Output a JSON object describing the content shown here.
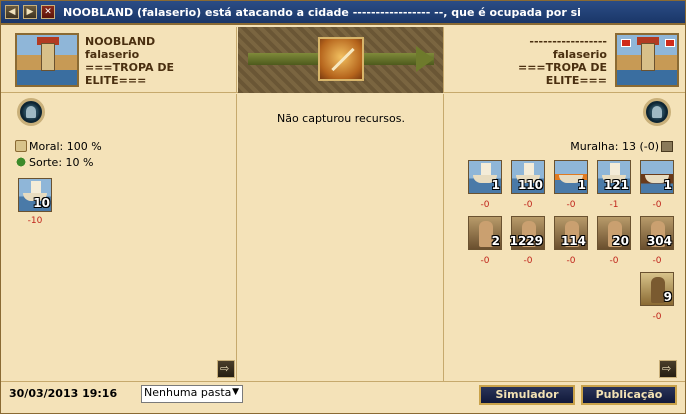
{
  "window": {
    "title": "NOOBLAND (falaserio) está atacando a cidade ----------------- --, que é ocupada por si",
    "buttons": {
      "prev": "◀",
      "next": "▶",
      "close": "✕"
    }
  },
  "attacker": {
    "town": "NOOBLAND",
    "player": "falaserio",
    "alliance_1": "===TROPA DE",
    "alliance_2": "ELITE===",
    "moral": "Moral: 100 %",
    "luck": "Sorte: 10 %",
    "units": [
      {
        "icon": "transport-boat-icon",
        "count": "10",
        "loss": "-10"
      }
    ]
  },
  "defender": {
    "town": "-----------------",
    "player": "falaserio",
    "alliance_1": "===TROPA DE",
    "alliance_2": "ELITE===",
    "wall": "Muralha: 13 (-0)",
    "units": [
      {
        "icon": "transport-boat-icon",
        "count": "1",
        "loss": "-0"
      },
      {
        "icon": "bireme-icon",
        "count": "110",
        "loss": "-0"
      },
      {
        "icon": "fire-ship-icon",
        "count": "1",
        "loss": "-0"
      },
      {
        "icon": "light-ship-icon",
        "count": "121",
        "loss": "-1"
      },
      {
        "icon": "trireme-icon",
        "count": "1",
        "loss": "-0"
      },
      {
        "icon": "swordsman-icon",
        "count": "2",
        "loss": "-0"
      },
      {
        "icon": "slinger-icon",
        "count": "1229",
        "loss": "-0"
      },
      {
        "icon": "archer-icon",
        "count": "114",
        "loss": "-0"
      },
      {
        "icon": "hoplite-icon",
        "count": "20",
        "loss": "-0"
      },
      {
        "icon": "horseman-icon",
        "count": "304",
        "loss": "-0"
      },
      {
        "icon": "catapult-icon",
        "count": "9",
        "loss": "-0"
      }
    ]
  },
  "middle": {
    "message": "Não capturou recursos."
  },
  "footer": {
    "date": "30/03/2013 19:16",
    "folder_selected": "Nenhuma pasta",
    "simulator_label": "Simulador",
    "publish_label": "Publicação"
  }
}
